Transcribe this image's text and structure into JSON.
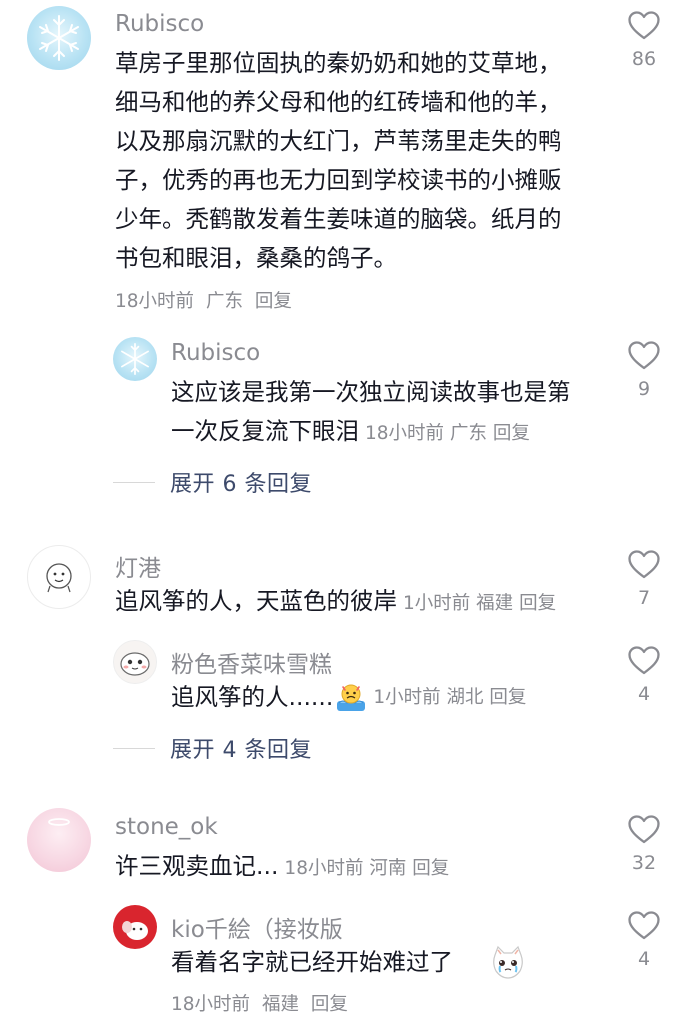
{
  "comments": [
    {
      "username": "Rubisco",
      "text_lines": [
        "草房子里那位固执的秦奶奶和她的艾草地，",
        "细马和他的养父母和他的红砖墙和他的羊，",
        "以及那扇沉默的大红门，芦苇荡里走失的鸭",
        "子，优秀的再也无力回到学校读书的小摊贩",
        "少年。秃鹤散发着生姜味道的脑袋。纸月的",
        "书包和眼泪，桑桑的鸽子。"
      ],
      "time": "18小时前",
      "location": "广东",
      "reply_label": "回复",
      "likes": "86",
      "avatar_icon": "snowflake-icon",
      "replies": [
        {
          "username": "Rubisco",
          "text_line1": "这应该是我第一次独立阅读故事也是第",
          "text_line2": "一次反复流下眼泪",
          "time": "18小时前",
          "location": "广东",
          "reply_label": "回复",
          "likes": "9",
          "avatar_icon": "snowflake-icon"
        }
      ],
      "expand_label": "展开 6 条回复"
    },
    {
      "username": "灯港",
      "text": "追风筝的人，天蓝色的彼岸",
      "time": "1小时前",
      "location": "福建",
      "reply_label": "回复",
      "likes": "7",
      "avatar_icon": "sketch-avatar-icon",
      "replies": [
        {
          "username": "粉色香菜味雪糕",
          "text": "追风筝的人......",
          "emoji_icon": "crying-face-emoji-icon",
          "time": "1小时前",
          "location": "湖北",
          "reply_label": "回复",
          "likes": "4",
          "avatar_icon": "cartoon-avatar-icon"
        }
      ],
      "expand_label": "展开 4 条回复"
    },
    {
      "username": "stone_ok",
      "text": "许三观卖血记...",
      "time": "18小时前",
      "location": "河南",
      "reply_label": "回复",
      "likes": "32",
      "avatar_icon": "pink-avatar-icon",
      "replies": [
        {
          "username": "kio千絵（接妆版",
          "text": "看着名字就已经开始难过了",
          "emoji_icon": "crying-cat-emoji-icon",
          "time": "18小时前",
          "location": "福建",
          "reply_label": "回复",
          "likes": "4",
          "avatar_icon": "red-cartoon-avatar-icon"
        }
      ]
    }
  ],
  "colors": {
    "text": "#161823",
    "secondary": "#8a8b91",
    "expand": "#3d4a6b",
    "heart_stroke": "#8a8b91"
  }
}
